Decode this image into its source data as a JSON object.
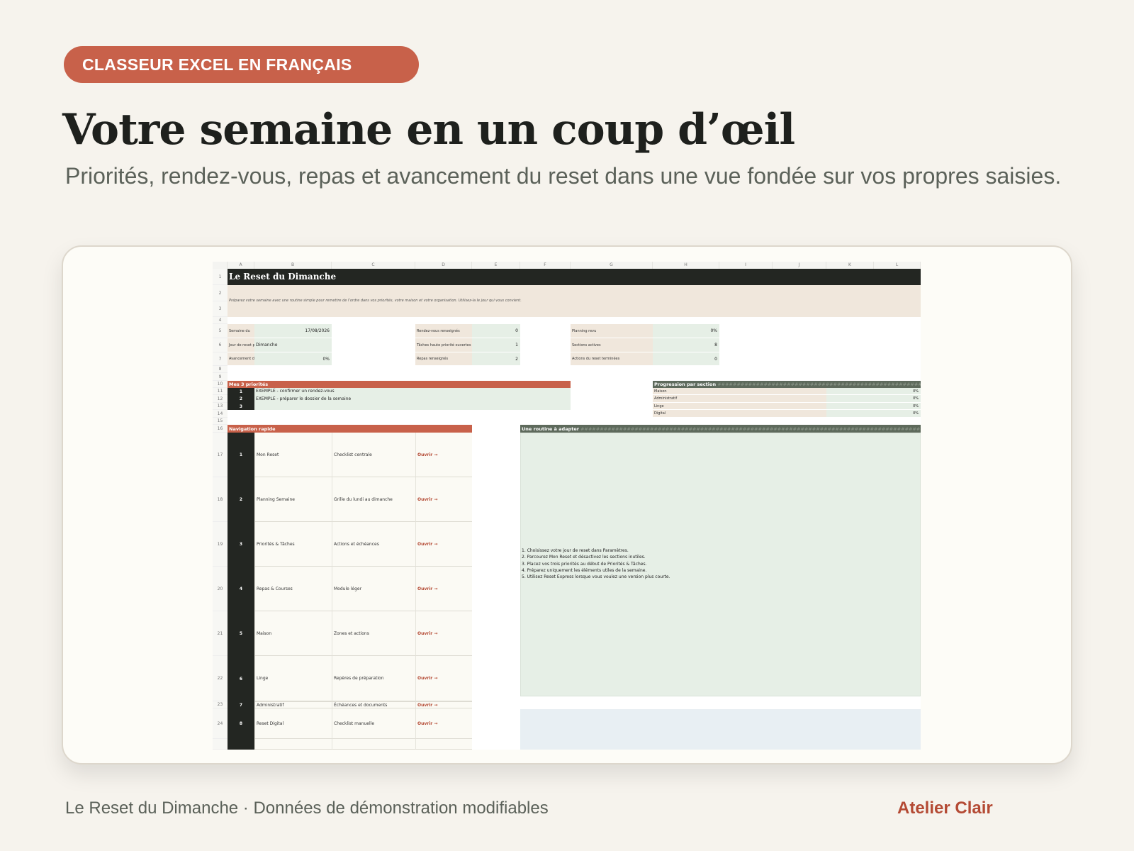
{
  "badge": "CLASSEUR EXCEL EN FRANÇAIS",
  "headline": "Votre semaine en un coup d’œil",
  "subline": "Priorités, rendez-vous, repas et avancement du reset dans une vue fondée sur vos propres saisies.",
  "sheet": {
    "columns": [
      "A",
      "B",
      "C",
      "D",
      "E",
      "F",
      "G",
      "H",
      "I",
      "J",
      "K",
      "L"
    ],
    "rows": [
      "1",
      "2",
      "3",
      "4",
      "5",
      "6",
      "7",
      "8",
      "9",
      "10",
      "11",
      "12",
      "13",
      "14",
      "15",
      "16",
      "17",
      "18",
      "19",
      "20",
      "21",
      "22",
      "23",
      "24"
    ],
    "title": "Le Reset du Dimanche",
    "intro": "Préparez votre semaine avec une routine simple pour remettre de l’ordre dans vos priorités, votre maison et votre organisation. Utilisez-la le jour qui vous convient.",
    "info_left": [
      {
        "label": "Semaine du",
        "value": "17/08/2026"
      },
      {
        "label": "Jour de reset p",
        "value": "Dimanche"
      },
      {
        "label": "Avancement d",
        "value": "0%"
      }
    ],
    "info_mid": [
      {
        "label": "Rendez-vous renseignés",
        "value": "0"
      },
      {
        "label": "Tâches haute priorité ouvertes",
        "value": "1"
      },
      {
        "label": "Repas renseignés",
        "value": "2"
      }
    ],
    "info_right": [
      {
        "label": "Planning revu",
        "value": "0%"
      },
      {
        "label": "Sections actives",
        "value": "8"
      },
      {
        "label": "Actions du reset terminées",
        "value": "0"
      }
    ],
    "priorities_header": "Mes 3 priorités",
    "priorities": [
      {
        "num": "1",
        "text": "EXEMPLE - confirmer un rendez-vous"
      },
      {
        "num": "2",
        "text": "EXEMPLE - préparer le dossier de la semaine"
      },
      {
        "num": "3",
        "text": ""
      }
    ],
    "progress_header": "Progression par section",
    "progress": [
      {
        "label": "Maison",
        "value": "0%"
      },
      {
        "label": "Administratif",
        "value": "0%"
      },
      {
        "label": "Linge",
        "value": "0%"
      },
      {
        "label": "Digital",
        "value": "0%"
      }
    ],
    "nav_header": "Navigation rapide",
    "nav": [
      {
        "num": "1",
        "name": "Mon Reset",
        "desc": "Checklist centrale",
        "link": "Ouvrir →"
      },
      {
        "num": "2",
        "name": "Planning Semaine",
        "desc": "Grille du lundi au dimanche",
        "link": "Ouvrir →"
      },
      {
        "num": "3",
        "name": "Priorités & Tâches",
        "desc": "Actions et échéances",
        "link": "Ouvrir →"
      },
      {
        "num": "4",
        "name": "Repas & Courses",
        "desc": "Module léger",
        "link": "Ouvrir →"
      },
      {
        "num": "5",
        "name": "Maison",
        "desc": "Zones et actions",
        "link": "Ouvrir →"
      },
      {
        "num": "6",
        "name": "Linge",
        "desc": "Repères de préparation",
        "link": "Ouvrir →"
      },
      {
        "num": "7",
        "name": "Administratif",
        "desc": "Échéances et documents",
        "link": "Ouvrir →"
      },
      {
        "num": "8",
        "name": "Reset Digital",
        "desc": "Checklist manuelle",
        "link": "Ouvrir →"
      }
    ],
    "routine_header": "Une routine à adapter",
    "routine_hash": "#########################################################################################",
    "routine_steps": [
      "1. Choisissez votre jour de reset dans Paramètres.",
      "2. Parcourez Mon Reset et désactivez les sections inutiles.",
      "3. Placez vos trois priorités au début de Priorités & Tâches.",
      "4. Préparez uniquement les éléments utiles de la semaine.",
      "5. Utilisez Reset Express lorsque vous voulez une version plus courte."
    ]
  },
  "footer_left": "Le Reset du Dimanche · Données de démonstration modifiables",
  "footer_right": "Atelier Clair",
  "colors": {
    "accent": "#c8614a",
    "dark": "#232622",
    "green_fill": "#e6efe6",
    "beige_fill": "#f0e7dc",
    "blue_fill": "#e8eff3",
    "page_bg": "#f6f3ed"
  }
}
